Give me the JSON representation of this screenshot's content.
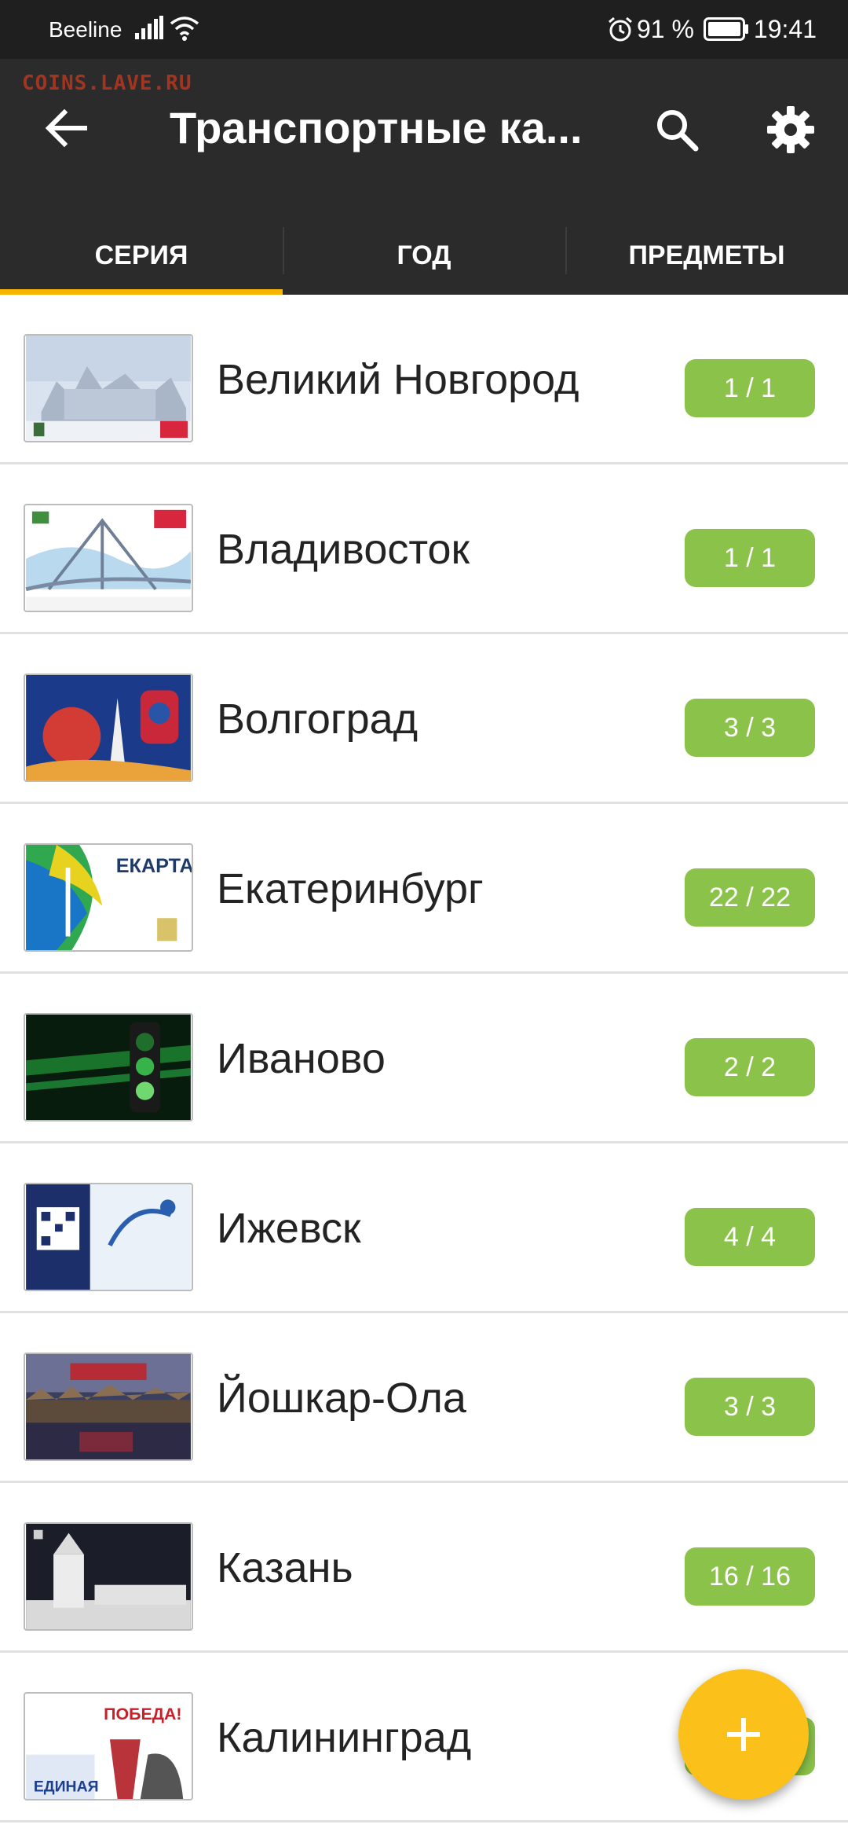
{
  "status_bar": {
    "carrier": "Beeline",
    "battery_percent": "91 %",
    "time": "19:41"
  },
  "app_bar": {
    "watermark": "COINS.LAVE.RU",
    "title": "Транспортные ка...",
    "icons": {
      "back": "arrow-back-icon",
      "search": "search-icon",
      "settings": "gear-icon"
    }
  },
  "tabs": [
    {
      "label": "СЕРИЯ",
      "active": true
    },
    {
      "label": "ГОД",
      "active": false
    },
    {
      "label": "ПРЕДМЕТЫ",
      "active": false
    }
  ],
  "items": [
    {
      "name": "Великий Новгород",
      "count": "1 / 1"
    },
    {
      "name": "Владивосток",
      "count": "1 / 1"
    },
    {
      "name": "Волгоград",
      "count": "3 / 3"
    },
    {
      "name": "Екатеринбург",
      "count": "22 / 22"
    },
    {
      "name": "Иваново",
      "count": "2 / 2"
    },
    {
      "name": "Ижевск",
      "count": "4 / 4"
    },
    {
      "name": "Йошкар-Ола",
      "count": "3 / 3"
    },
    {
      "name": "Казань",
      "count": "16 / 16"
    },
    {
      "name": "Калининград",
      "count": ""
    }
  ],
  "fab": {
    "icon": "plus-icon"
  },
  "colors": {
    "app_bar": "#2b2b2b",
    "status_bar": "#1f1f1f",
    "tab_indicator": "#f7b500",
    "badge": "#8bc34a",
    "fab": "#fbc01a"
  }
}
